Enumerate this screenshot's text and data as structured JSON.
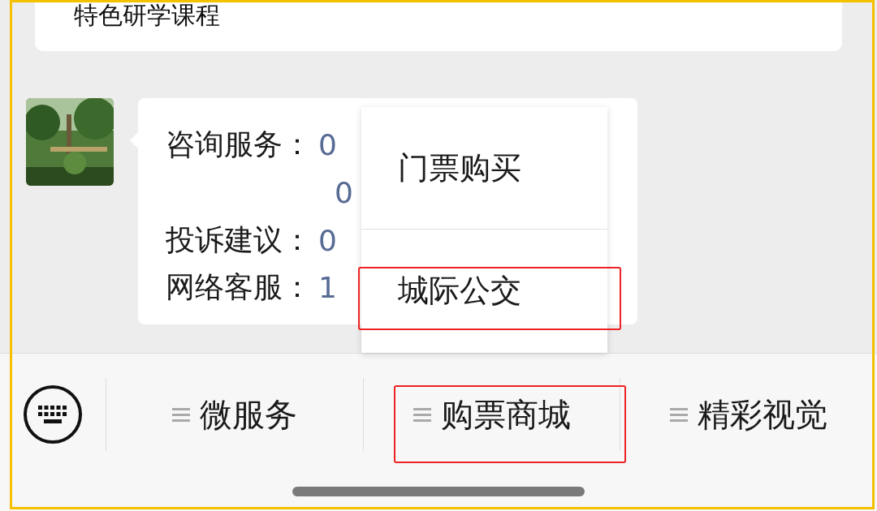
{
  "frame_highlighted": true,
  "top_card": {
    "text": "特色研学课程"
  },
  "message": {
    "lines": [
      {
        "label": "咨询服务：",
        "value": "0"
      },
      {
        "value": "0"
      },
      {
        "label": "投诉建议：",
        "value": "0"
      },
      {
        "label": "网络客服：",
        "value": "1"
      }
    ]
  },
  "menu_bar": {
    "tabs": [
      {
        "label": "微服务",
        "highlighted": false
      },
      {
        "label": "购票商城",
        "highlighted": true,
        "submenu": [
          {
            "label": "门票购买",
            "highlighted": false
          },
          {
            "label": "城际公交",
            "highlighted": true
          }
        ]
      },
      {
        "label": "精彩视觉",
        "highlighted": false
      }
    ]
  }
}
